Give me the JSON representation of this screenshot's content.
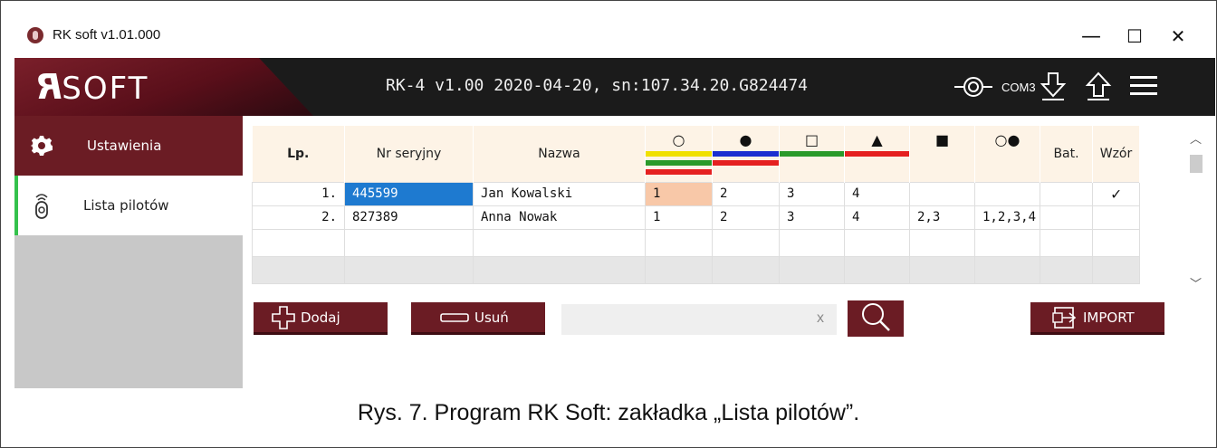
{
  "window": {
    "title": "RK soft v1.01.000",
    "minimize_glyph": "—",
    "maximize_glyph": "☐",
    "close_glyph": "✕"
  },
  "header": {
    "logo_r": "R",
    "logo_soft": "SOFT",
    "device_info": "RK-4 v1.00 2020-04-20, sn:107.34.20.G824474",
    "port": "COM3",
    "icons": [
      "port-connector-icon",
      "download-icon",
      "upload-icon",
      "menu-icon"
    ]
  },
  "sidebar": {
    "items": [
      {
        "label": "Ustawienia",
        "icon": "gear-icon",
        "active": false
      },
      {
        "label": "Lista pilotów",
        "icon": "remote-icon",
        "active": true
      }
    ]
  },
  "table": {
    "columns": [
      "Lp.",
      "Nr seryjny",
      "Nazwa",
      "○",
      "●",
      "□",
      "▲",
      "■",
      "○●",
      "Bat.",
      "Wzór"
    ],
    "button_colors": {
      "c1": [
        "#f0e000",
        "#2a9a2a",
        "#e52020"
      ],
      "c2": [
        "#1a2fd0",
        "#e52020"
      ],
      "c3": [
        "#2a9a2a"
      ],
      "c4": [
        "#e52020"
      ]
    },
    "rows": [
      {
        "lp": "1.",
        "serial": "445599",
        "name": "Jan Kowalski",
        "b1": "1",
        "b2": "2",
        "b3": "3",
        "b4": "4",
        "b5": "",
        "b6": "",
        "bat": "",
        "wzor": "✓"
      },
      {
        "lp": "2.",
        "serial": "827389",
        "name": "Anna Nowak",
        "b1": "1",
        "b2": "2",
        "b3": "3",
        "b4": "4",
        "b5": "2,3",
        "b6": "1,2,3,4",
        "bat": "",
        "wzor": ""
      }
    ]
  },
  "toolbar": {
    "add_label": "Dodaj",
    "remove_label": "Usuń",
    "search_value": "",
    "search_clear": "x",
    "import_label": "IMPORT"
  },
  "caption": "Rys. 7. Program RK Soft: zakładka „Lista pilotów”."
}
